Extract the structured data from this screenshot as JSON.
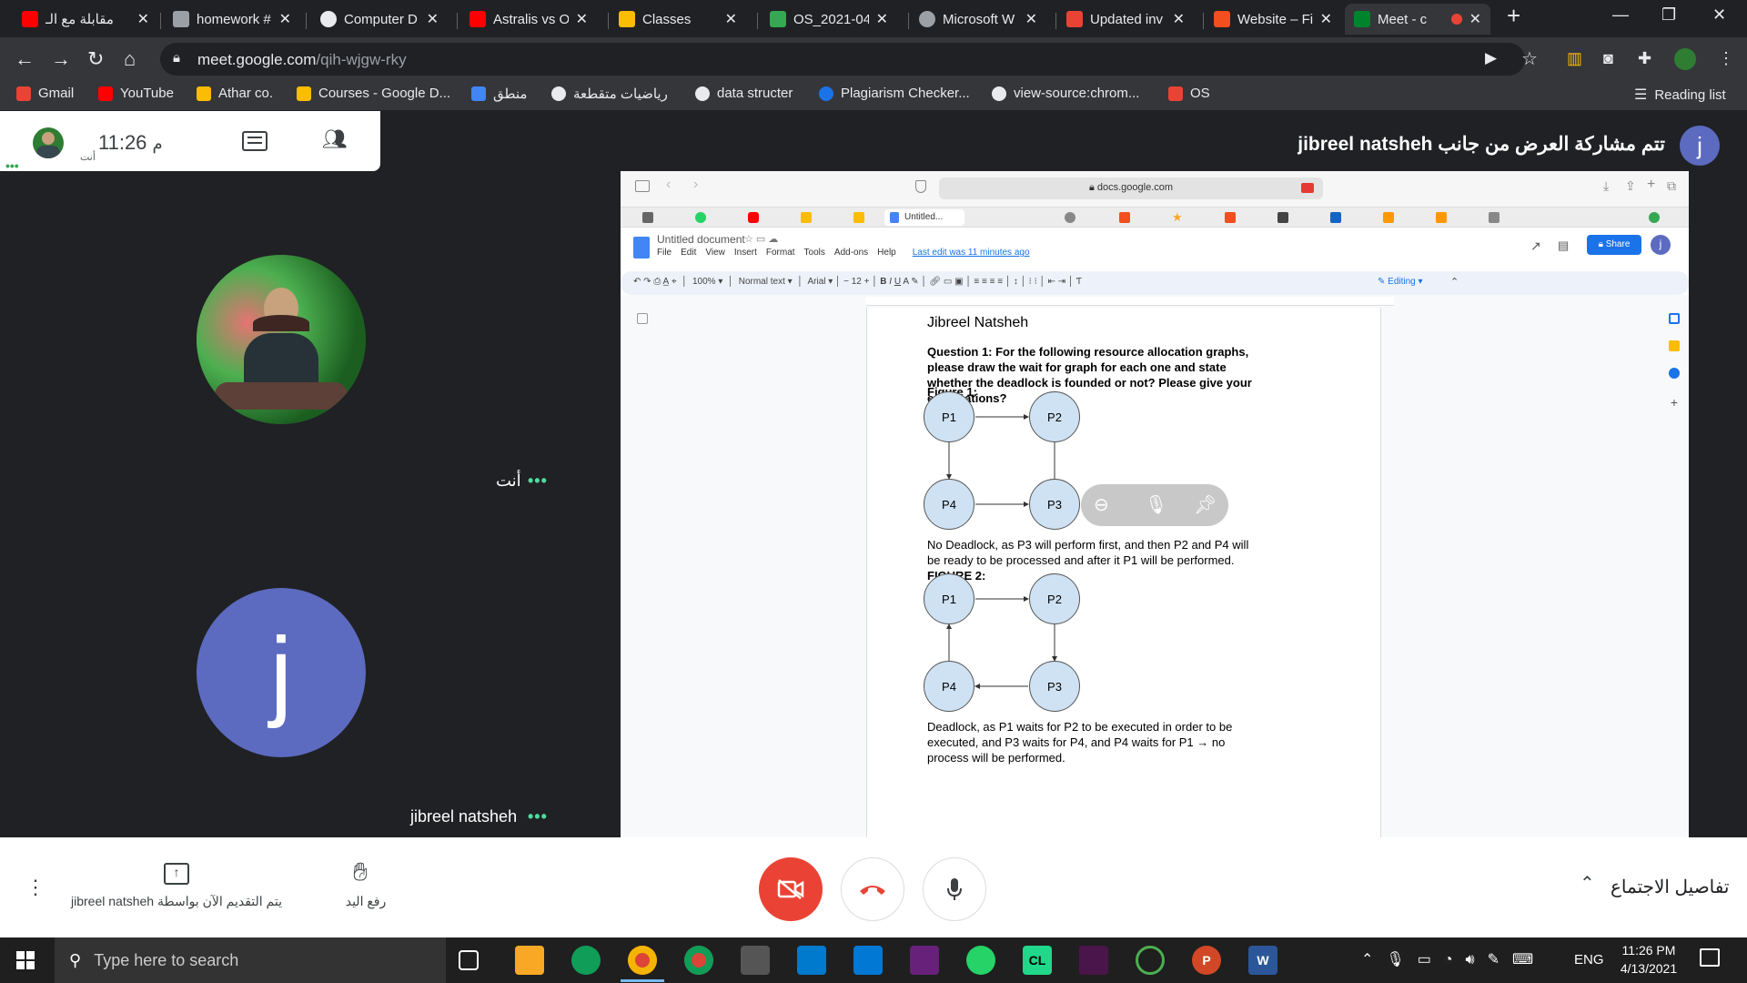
{
  "browser": {
    "tabs": [
      {
        "title": "مقابلة مع الـ",
        "color": "#ff0000",
        "active": false
      },
      {
        "title": "homework #",
        "color": "#e8eaed",
        "active": false
      },
      {
        "title": "Computer D",
        "color": "#e8eaed",
        "active": false
      },
      {
        "title": "Astralis vs O",
        "color": "#ff0000",
        "active": false
      },
      {
        "title": "Classes",
        "color": "#fbbc04",
        "active": false
      },
      {
        "title": "OS_2021-04",
        "color": "#34a853",
        "active": false
      },
      {
        "title": "Microsoft W",
        "color": "#9aa0a6",
        "active": false
      },
      {
        "title": "Updated inv",
        "color": "#ea4335",
        "active": false
      },
      {
        "title": "Website – Fi",
        "color": "#f24e1e",
        "active": false
      },
      {
        "title": "Meet - c",
        "color": "#00832d",
        "active": true
      }
    ],
    "url_host": "meet.google.com",
    "url_path": "/qih-wjgw-rky",
    "bookmarks": [
      {
        "label": "Gmail",
        "color": "#ea4335"
      },
      {
        "label": "YouTube",
        "color": "#ff0000"
      },
      {
        "label": "Athar co.",
        "color": "#fbbc04"
      },
      {
        "label": "Courses - Google D...",
        "color": "#fbbc04"
      },
      {
        "label": "منطق",
        "color": "#4285f4"
      },
      {
        "label": "رياضيات متقطعة",
        "color": "#e8eaed"
      },
      {
        "label": "data structer",
        "color": "#e8eaed"
      },
      {
        "label": "Plagiarism Checker...",
        "color": "#1a73e8"
      },
      {
        "label": "view-source:chrom...",
        "color": "#e8eaed"
      },
      {
        "label": "OS",
        "color": "#ea4335"
      }
    ],
    "reading_list": "Reading list"
  },
  "meet": {
    "self_time": "11:26",
    "self_time_suffix": "م",
    "self_you_label": "أنت",
    "presenting_banner": "تتم مشاركة العرض من جانب jibreel natsheh",
    "avatar_letter": "j",
    "tile1_name": "أنت",
    "tile2_name": "jibreel natsheh",
    "tile2_letter": "j",
    "presenting_now": "يتم التقديم الآن بواسطة jibreel natsheh",
    "raise_hand": "رفع اليد",
    "meeting_details": "تفاصيل الاجتماع",
    "accent": "#5c6bc0"
  },
  "shared": {
    "address": "docs.google.com",
    "doc_title": "Untitled document",
    "menu": [
      "File",
      "Edit",
      "View",
      "Insert",
      "Format",
      "Tools",
      "Add-ons",
      "Help"
    ],
    "last_edit": "Last edit was 11 minutes ago",
    "share_label": "Share",
    "editing_label": "Editing",
    "tab_label": "Untitled...",
    "zoom": "100%",
    "style": "Normal text",
    "font": "Arial",
    "font_size": "12",
    "author": "Jibreel Natsheh",
    "question": "Question 1: For the following resource allocation graphs, please draw the wait for graph for each one and state whether the deadlock is founded or not? Please give your explanations?",
    "fig1_label": "Figure 1:",
    "fig1_nodes": [
      "P1",
      "P2",
      "P4",
      "P3"
    ],
    "fig1_answer": "No Deadlock, as P3 will perform first, and then P2 and P4 will be ready to be processed and after it P1 will be performed.",
    "fig2_label": "FIGURE 2:",
    "fig2_nodes": [
      "P1",
      "P2",
      "P4",
      "P3"
    ],
    "fig2_answer": "Deadlock, as P1 waits for P2 to be executed in order to be executed, and P3 waits for P4, and P4 waits for P1 → no process will be performed."
  },
  "taskbar": {
    "search_placeholder": "Type here to search",
    "lang": "ENG",
    "time": "11:26 PM",
    "date": "4/13/2021"
  }
}
